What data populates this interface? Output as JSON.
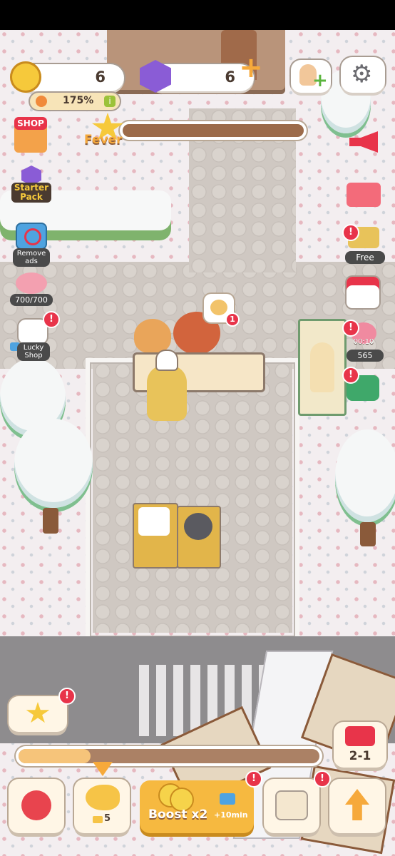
{
  "hud": {
    "coins": "6",
    "gems": "6",
    "profit_percent": "175%",
    "fever_label": "Fever"
  },
  "left_menu": {
    "shop_label": "SHOP",
    "starter_pack_label": "Starter Pack",
    "remove_ads_label": "Remove ads",
    "piggy_label": "700/700",
    "lucky_shop_label": "Lucky Shop"
  },
  "right_menu": {
    "free_label": "Free",
    "bouquet_count": "565",
    "bouquet_timer": "00:10"
  },
  "customer_order_badge": "1",
  "badges": {
    "alert": "!"
  },
  "bottom_bar": {
    "level_label": "2-1",
    "taiyaki_count": "5",
    "boost_label": "Boost x2",
    "boost_time": "+10min",
    "level_progress_fraction": 0.24,
    "fever_progress_fraction": 0.0
  },
  "colors": {
    "accent_orange": "#f6a93b",
    "gem_purple": "#8a5cd6",
    "badge_red": "#e8344a",
    "progress_brown": "#9c6b4a"
  }
}
